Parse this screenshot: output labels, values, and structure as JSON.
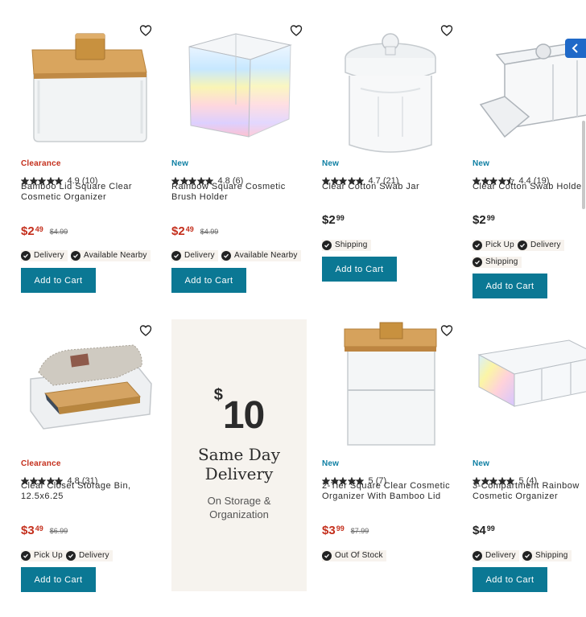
{
  "products": [
    {
      "badge": "Clearance",
      "badge_type": "clear",
      "rating": "4.9",
      "reviews": "(10)",
      "stars": 5,
      "name_lines": [
        "Bamboo Lid Square Clear",
        "Cosmetic Organizer"
      ],
      "price_dollars": "$2",
      "price_cents": "49",
      "was": "$4.99",
      "price_style": "sale",
      "chips": [
        "Delivery",
        "Available Nearby"
      ],
      "button": "Add to Cart"
    },
    {
      "badge": "New",
      "badge_type": "new",
      "rating": "4.8",
      "reviews": "(6)",
      "stars": 5,
      "name_lines": [
        "Rainbow Square Cosmetic",
        "Brush Holder"
      ],
      "price_dollars": "$2",
      "price_cents": "49",
      "was": "$4.99",
      "price_style": "sale",
      "chips": [
        "Delivery",
        "Available Nearby"
      ],
      "button": "Add to Cart"
    },
    {
      "badge": "New",
      "badge_type": "new",
      "rating": "4.7",
      "reviews": "(21)",
      "stars": 5,
      "name_lines": [
        "Clear Cotton Swab Jar"
      ],
      "price_dollars": "$2",
      "price_cents": "99",
      "was": "",
      "price_style": "reg",
      "chips": [
        "Shipping"
      ],
      "button": "Add to Cart"
    },
    {
      "badge": "New",
      "badge_type": "new",
      "rating": "4.4",
      "reviews": "(19)",
      "stars": 4.5,
      "name_lines": [
        "Clear Cotton Swab Holder"
      ],
      "price_dollars": "$2",
      "price_cents": "99",
      "was": "",
      "price_style": "reg",
      "chips": [
        "Pick Up",
        "Delivery",
        "Shipping"
      ],
      "button": "Add to Cart"
    },
    {
      "badge": "Clearance",
      "badge_type": "clear",
      "rating": "4.8",
      "reviews": "(31)",
      "stars": 5,
      "name_lines": [
        "Clear Closet Storage Bin,",
        "12.5x6.25"
      ],
      "price_dollars": "$3",
      "price_cents": "49",
      "was": "$6.99",
      "price_style": "sale",
      "chips": [
        "Pick Up",
        "Delivery"
      ],
      "button": "Add to Cart"
    },
    {
      "badge": "New",
      "badge_type": "new",
      "rating": "5",
      "reviews": "(7)",
      "stars": 5,
      "name_lines": [
        "2-Tier Square Clear Cosmetic",
        "Organizer With Bamboo Lid"
      ],
      "price_dollars": "$3",
      "price_cents": "99",
      "was": "$7.99",
      "price_style": "sale",
      "chips": [
        "Out Of Stock"
      ],
      "button": ""
    },
    {
      "badge": "New",
      "badge_type": "new",
      "rating": "5",
      "reviews": "(4)",
      "stars": 5,
      "name_lines": [
        "3-Compartment Rainbow",
        "Cosmetic Organizer"
      ],
      "price_dollars": "$4",
      "price_cents": "99",
      "was": "",
      "price_style": "reg",
      "chips": [
        "Delivery",
        "Shipping"
      ],
      "button": "Add to Cart"
    }
  ],
  "promo": {
    "currency": "$",
    "amount": "10",
    "headline_1": "Same Day",
    "headline_2": "Delivery",
    "sub_1": "On Storage &",
    "sub_2": "Organization"
  },
  "colors": {
    "clearance": "#c42f1c",
    "new": "#0e7fa3",
    "button": "#0b7894",
    "promo_bg": "#f6f3ee"
  },
  "icons": {
    "wishlist": "heart-outline-icon",
    "check": "check-circle-icon",
    "nav": "chevron-left-icon"
  }
}
